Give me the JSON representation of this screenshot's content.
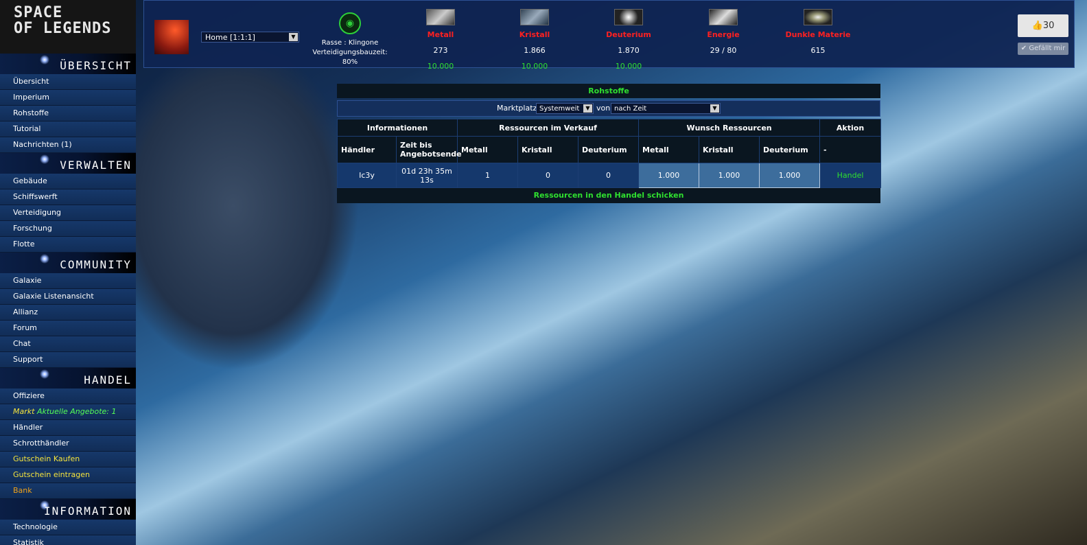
{
  "logo": {
    "line1": "SPACE",
    "line2": "OF LEGENDS"
  },
  "sidebar": {
    "sections": [
      {
        "title": "Übersicht",
        "items": [
          "Übersicht",
          "Imperium",
          "Rohstoffe",
          "Tutorial",
          "Nachrichten (1)"
        ]
      },
      {
        "title": "Verwalten",
        "items": [
          "Gebäude",
          "Schiffswerft",
          "Verteidigung",
          "Forschung",
          "Flotte"
        ]
      },
      {
        "title": "Community",
        "items": [
          "Galaxie",
          "Galaxie Listenansicht",
          "Allianz",
          "Forum",
          "Chat",
          "Support"
        ]
      },
      {
        "title": "Handel"
      },
      {
        "title": "Information",
        "items": [
          "Technologie",
          "Statistik"
        ]
      }
    ],
    "handel": {
      "offiziere": "Offiziere",
      "markt": "Markt",
      "markt_offers": "Aktuelle Angebote: 1",
      "haendler": "Händler",
      "schrott": "Schrotthändler",
      "gutschein_kaufen": "Gutschein Kaufen",
      "gutschein_eintragen": "Gutschein eintragen",
      "bank": "Bank"
    }
  },
  "topbar": {
    "planet_select": "Home [1:1:1]",
    "race": "Rasse : Klingone",
    "defense_label": "Verteidigungsbauzeit:",
    "defense_value": "80%",
    "resources": [
      {
        "name": "Metall",
        "value": "273",
        "max": "10.000",
        "icon": "metal-icon"
      },
      {
        "name": "Kristall",
        "value": "1.866",
        "max": "10.000",
        "icon": "crystal-icon"
      },
      {
        "name": "Deuterium",
        "value": "1.870",
        "max": "10.000",
        "icon": "deuterium-icon"
      },
      {
        "name": "Energie",
        "value": "29 / 80",
        "max": "",
        "icon": "energy-icon"
      },
      {
        "name": "Dunkle Materie",
        "value": "615",
        "max": "",
        "icon": "dark-matter-icon"
      }
    ],
    "like_count": "30",
    "like_label": "✔ Gefällt mir"
  },
  "market": {
    "title": "Rohstoffe",
    "filter_label": "Marktplatz",
    "filter_scope": "Systemweit",
    "filter_von": "von",
    "filter_sort": "nach Zeit",
    "groups": [
      "Informationen",
      "Ressourcen im Verkauf",
      "Wunsch Ressourcen",
      "Aktion"
    ],
    "columns": [
      "Händler",
      "Zeit bis Angebotsende",
      "Metall",
      "Kristall",
      "Deuterium",
      "Metall",
      "Kristall",
      "Deuterium",
      "-"
    ],
    "rows": [
      {
        "haendler": "Ic3y",
        "zeit": "01d 23h 35m 13s",
        "sell_metall": "1",
        "sell_kristall": "0",
        "sell_deuterium": "0",
        "want_metall": "1.000",
        "want_kristall": "1.000",
        "want_deuterium": "1.000",
        "action": "Handel"
      }
    ],
    "send_label": "Ressourcen in den Handel schicken"
  },
  "colors": {
    "resource_name": "#ff2020",
    "max_value": "#2fe02f",
    "accent_green": "#2fe02f",
    "nav_yellow": "#f5e43c",
    "nav_orange": "#f0a21a"
  }
}
